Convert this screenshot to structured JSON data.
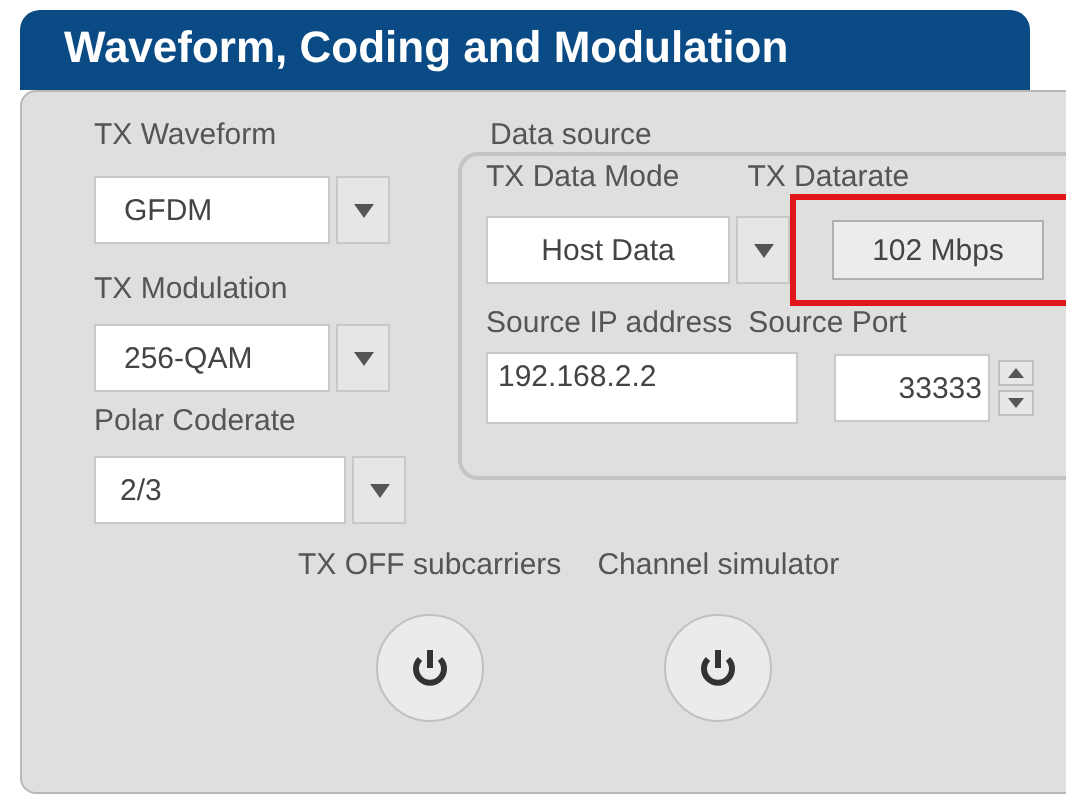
{
  "panel": {
    "title": "Waveform, Coding and Modulation"
  },
  "left_fields": [
    {
      "label": "TX Waveform",
      "value": "GFDM"
    },
    {
      "label": "TX Modulation",
      "value": "256-QAM"
    },
    {
      "label": "Polar Coderate",
      "value": "2/3"
    }
  ],
  "data_source": {
    "label": "Data source",
    "mode_label": "TX Data Mode",
    "mode_value": "Host Data",
    "datarate_label": "TX Datarate",
    "datarate_value": "102 Mbps",
    "datarate_highlighted": true,
    "ip_label": "Source IP address",
    "ip_value": "192.168.2.2",
    "port_label": "Source Port",
    "port_value": "33333"
  },
  "toggles": [
    {
      "label": "TX OFF subcarriers"
    },
    {
      "label": "Channel simulator"
    }
  ]
}
